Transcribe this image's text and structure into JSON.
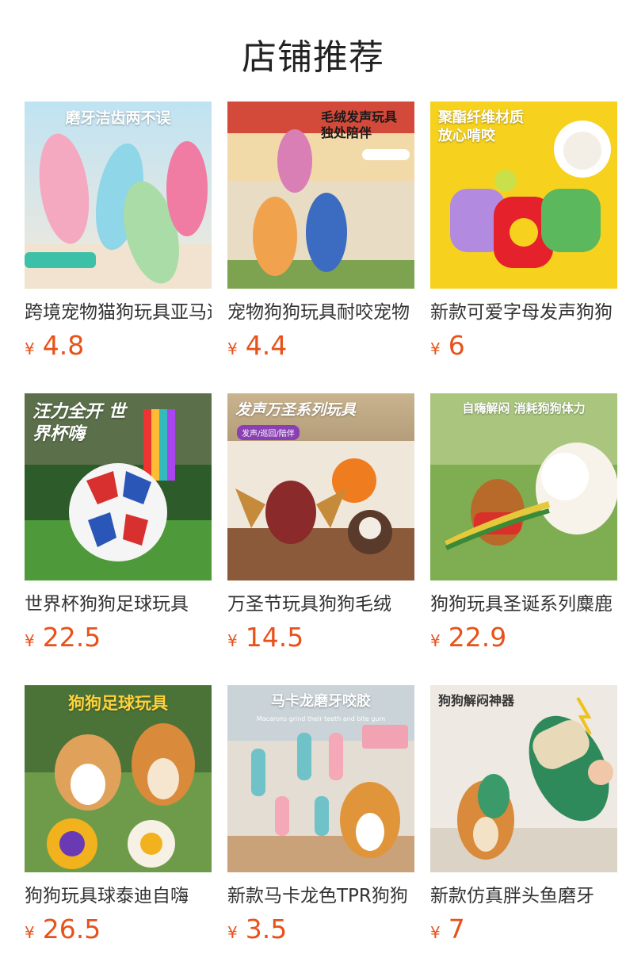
{
  "page": {
    "title": "店铺推荐"
  },
  "products": [
    {
      "name": "跨境宠物猫狗玩具亚马逊",
      "currency": "¥",
      "price": "4.8",
      "promo": "磨牙洁齿两不误",
      "promo_sub": "",
      "promo_color": "#ffffff",
      "image": "pink-blue-green-slipper-chew-toys"
    },
    {
      "name": "宠物狗狗玩具耐咬宠物",
      "currency": "¥",
      "price": "4.4",
      "promo": "毛绒发声玩具 独处陪伴",
      "promo_sub": "",
      "promo_color": "#1a1a1a",
      "image": "plush-animal-squeaky-toys"
    },
    {
      "name": "新款可爱字母发声狗狗",
      "currency": "¥",
      "price": "6",
      "promo": "聚酯纤维材质 放心啃咬",
      "promo_sub": "",
      "promo_color": "#ffffff",
      "image": "letter-shaped-plush-toys"
    },
    {
      "name": "世界杯狗狗足球玩具",
      "currency": "¥",
      "price": "22.5",
      "promo": "汪力全开 世界杯嗨",
      "promo_sub": "",
      "promo_color": "#ffffff",
      "image": "dog-football-with-tabs"
    },
    {
      "name": "万圣节玩具狗狗毛绒",
      "currency": "¥",
      "price": "14.5",
      "promo": "发声万圣系列玩具",
      "promo_sub": "发声/巡回/陪伴",
      "promo_color": "#ffffff",
      "image": "halloween-bat-pumpkin-plush"
    },
    {
      "name": "狗狗玩具圣诞系列麋鹿",
      "currency": "¥",
      "price": "22.9",
      "promo": "自嗨解闷 消耗狗狗体力",
      "promo_sub": "",
      "promo_color": "#ffffff",
      "image": "white-poodle-with-plush-toy"
    },
    {
      "name": "狗狗玩具球泰迪自嗨",
      "currency": "¥",
      "price": "26.5",
      "promo": "狗狗足球玩具",
      "promo_sub": "",
      "promo_color": "#ffd23a",
      "image": "corgi-shiba-with-balls"
    },
    {
      "name": "新款马卡龙色TPR狗狗",
      "currency": "¥",
      "price": "3.5",
      "promo": "马卡龙磨牙咬胶",
      "promo_sub": "Macarons grind their teeth and bite gum",
      "promo_color": "#ffffff",
      "image": "macaron-tpr-chew-toys-corgi"
    },
    {
      "name": "新款仿真胖头鱼磨牙",
      "currency": "¥",
      "price": "7",
      "promo": "狗狗解闷神器",
      "promo_sub": "",
      "promo_color": "#333333",
      "image": "fat-fish-plush-shiba"
    }
  ]
}
